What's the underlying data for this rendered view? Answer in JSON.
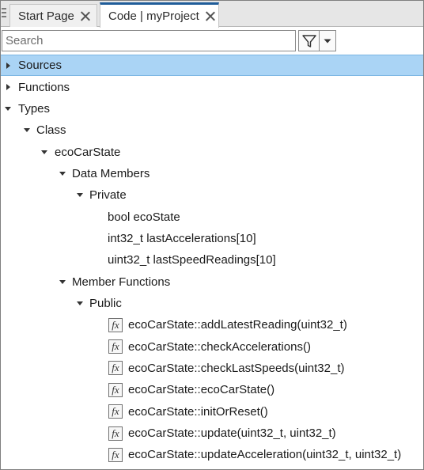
{
  "tabs": [
    {
      "label": "Start Page"
    },
    {
      "label": "Code | myProject"
    }
  ],
  "search": {
    "placeholder": "Search",
    "value": ""
  },
  "toolbar": {
    "filter_icon": "funnel-icon",
    "dropdown_icon": "chevron-down-icon"
  },
  "colors": {
    "selected_row": "#aad4f5",
    "active_tab_accent": "#1f5c99"
  },
  "tree": {
    "sources": "Sources",
    "functions": "Functions",
    "types": "Types",
    "class": "Class",
    "eco_car_state": "ecoCarState",
    "data_members": "Data Members",
    "private": "Private",
    "private_members": [
      "bool ecoState",
      "int32_t lastAccelerations[10]",
      "uint32_t lastSpeedReadings[10]"
    ],
    "member_functions": "Member Functions",
    "public": "Public",
    "fx_glyph": "fx",
    "public_functions": [
      "ecoCarState::addLatestReading(uint32_t)",
      "ecoCarState::checkAccelerations()",
      "ecoCarState::checkLastSpeeds(uint32_t)",
      "ecoCarState::ecoCarState()",
      "ecoCarState::initOrReset()",
      "ecoCarState::update(uint32_t, uint32_t)",
      "ecoCarState::updateAcceleration(uint32_t, uint32_t)"
    ]
  }
}
